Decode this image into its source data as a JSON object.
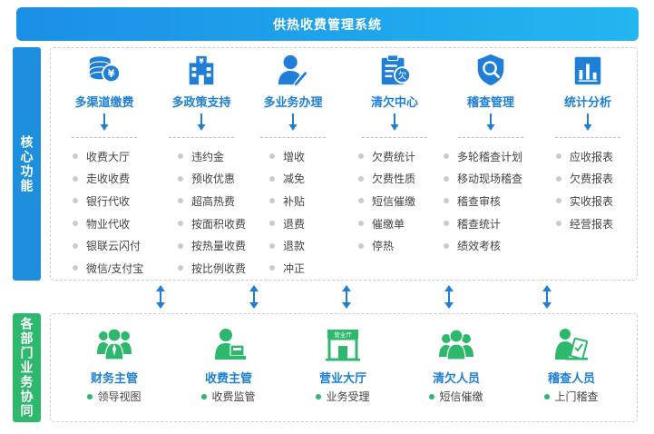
{
  "title": "供热收费管理系统",
  "side": {
    "core": "核心功能",
    "dept": "各部门业务协同"
  },
  "colors": {
    "title_bar": "#1e9be9",
    "core_accent": "#1e8fdc",
    "dept_accent": "#2db86d",
    "icon_blue": "#1f7fd6",
    "icon_green": "#2db86d"
  },
  "modules": [
    {
      "name": "多渠道缴费",
      "icon": "coin-stack-yen-icon",
      "items": [
        "收费大厅",
        "走收收费",
        "银行代收",
        "物业代收",
        "银联云闪付",
        "微信/支付宝"
      ]
    },
    {
      "name": "多政策支持",
      "icon": "building-yen-icon",
      "items": [
        "违约金",
        "预收优惠",
        "超高热费",
        "按面积收费",
        "按热量收费",
        "按比例收费"
      ]
    },
    {
      "name": "多业务办理",
      "icon": "user-pen-icon",
      "items": [
        "增收",
        "减免",
        "补贴",
        "退费",
        "退款",
        "冲正"
      ]
    },
    {
      "name": "清欠中心",
      "icon": "clipboard-arrears-icon",
      "items": [
        "欠费统计",
        "欠费性质",
        "短信催缴",
        "催缴单",
        "停热"
      ]
    },
    {
      "name": "稽查管理",
      "icon": "shield-search-icon",
      "items": [
        "多轮稽查计划",
        "移动现场稽查",
        "稽查审核",
        "稽查统计",
        "绩效考核"
      ]
    },
    {
      "name": "统计分析",
      "icon": "bar-chart-icon",
      "items": [
        "应收报表",
        "欠费报表",
        "实收报表",
        "经营报表"
      ]
    }
  ],
  "departments": [
    {
      "name": "财务主管",
      "desc": "领导视图",
      "icon": "team-icon"
    },
    {
      "name": "收费主管",
      "desc": "收费监管",
      "icon": "cashier-icon"
    },
    {
      "name": "营业大厅",
      "desc": "业务受理",
      "icon": "service-hall-icon",
      "sign": "营业厅"
    },
    {
      "name": "清欠人员",
      "desc": "短信催缴",
      "icon": "staff-group-icon"
    },
    {
      "name": "稽查人员",
      "desc": "上门稽查",
      "icon": "inspector-icon"
    }
  ]
}
